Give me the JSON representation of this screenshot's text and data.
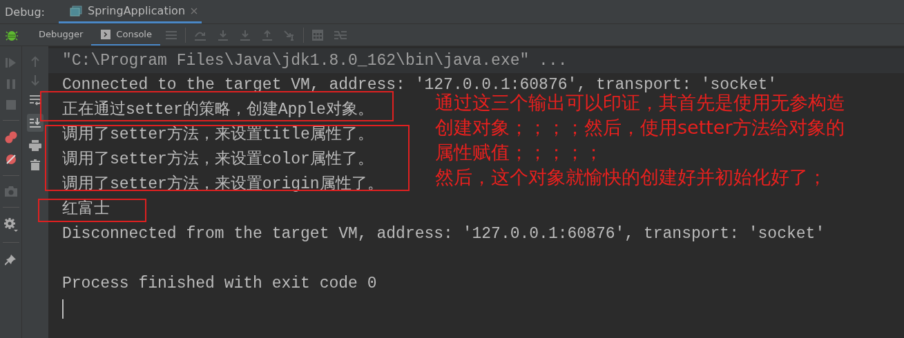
{
  "header": {
    "label": "Debug:",
    "tabs": [
      {
        "label": "SpringApplication",
        "selected": true
      }
    ]
  },
  "toolbar": {
    "tabs": [
      {
        "label": "Debugger",
        "selected": false
      },
      {
        "label": "Console",
        "selected": true
      }
    ]
  },
  "console": {
    "lines": [
      {
        "kind": "command",
        "text": "\"C:\\Program Files\\Java\\jdk1.8.0_162\\bin\\java.exe\" ..."
      },
      {
        "kind": "output",
        "text": "Connected to the target VM, address: '127.0.0.1:60876', transport: 'socket'"
      },
      {
        "kind": "output",
        "text": "正在通过setter的策略，创建Apple对象。"
      },
      {
        "kind": "output",
        "text": "调用了setter方法，来设置title属性了。"
      },
      {
        "kind": "output",
        "text": "调用了setter方法，来设置color属性了。"
      },
      {
        "kind": "output",
        "text": "调用了setter方法，来设置origin属性了。"
      },
      {
        "kind": "output",
        "text": "红富士"
      },
      {
        "kind": "output",
        "text": "Disconnected from the target VM, address: '127.0.0.1:60876', transport: 'socket'"
      },
      {
        "kind": "blank"
      },
      {
        "kind": "output",
        "text": "Process finished with exit code 0"
      },
      {
        "kind": "cursor"
      }
    ]
  },
  "annotation": {
    "lines": [
      "通过这三个输出可以印证，其首先是使用无参构造",
      "创建对象；；；；然后，使用setter方法给对象的",
      "属性赋值；；；；；",
      "然后，这个对象就愉快的创建好并初始化好了；"
    ]
  }
}
